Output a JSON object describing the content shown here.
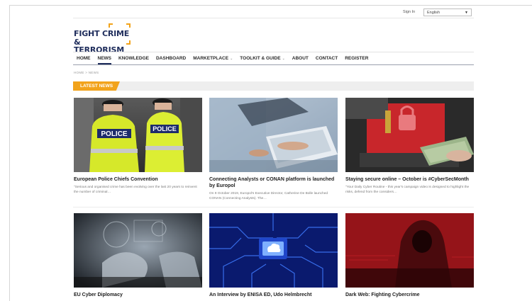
{
  "topbar": {
    "signin": "Sign In",
    "language": "English"
  },
  "logo": {
    "line1": "FIGHT CRIME",
    "line2": "& TERRORISM"
  },
  "nav": [
    {
      "label": "HOME",
      "dropdown": false
    },
    {
      "label": "NEWS",
      "dropdown": false,
      "active": true
    },
    {
      "label": "KNOWLEDGE",
      "dropdown": false
    },
    {
      "label": "DASHBOARD",
      "dropdown": false
    },
    {
      "label": "MARKETPLACE",
      "dropdown": true
    },
    {
      "label": "TOOLKIT & GUIDE",
      "dropdown": true
    },
    {
      "label": "ABOUT",
      "dropdown": false
    },
    {
      "label": "CONTACT",
      "dropdown": false
    },
    {
      "label": "REGISTER",
      "dropdown": false
    }
  ],
  "breadcrumb": "HOME > NEWS",
  "section": {
    "title": "LATEST NEWS",
    "color": "#f2a31b"
  },
  "articles": [
    {
      "title": "European Police Chiefs Convention",
      "excerpt": "\"Serious and organised crime has been evolving over the last 20 years to reinvent the number of criminal…",
      "image": "police-officers-photo"
    },
    {
      "title": "Connecting Analysts or CONAN platform is launched by Europol",
      "excerpt": "On 9 October 2019, Europol's Executive Director, Catherine De Bolle launched CONAN (Connecting Analysts). The…",
      "image": "analysts-laptop-photo"
    },
    {
      "title": "Staying secure online – October is #CyberSecMonth",
      "excerpt": "\"Your Daily Cyber Routine - this year's campaign video is designed to highlight the risks, defend from the considers…",
      "image": "ransomware-laptop-photo"
    },
    {
      "title": "EU Cyber Diplomacy",
      "excerpt": "",
      "image": "digital-hands-photo"
    },
    {
      "title": "An Interview by ENISA ED, Udo Helmbrecht",
      "excerpt": "",
      "image": "circuit-board-cloud-photo"
    },
    {
      "title": "Dark Web: Fighting Cybercrime",
      "excerpt": "",
      "image": "hooded-hacker-photo"
    }
  ]
}
